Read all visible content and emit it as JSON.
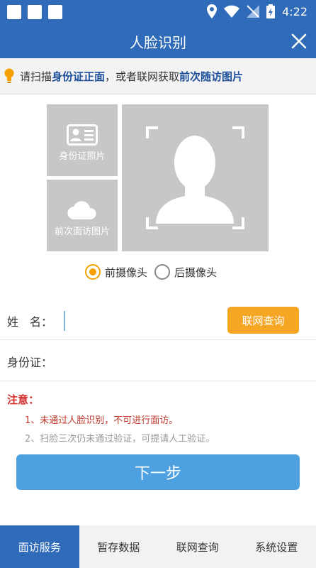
{
  "status_bar": {
    "time": "4:22"
  },
  "header": {
    "title": "人脸识别"
  },
  "tip": {
    "prefix": "请扫描",
    "highlight1": "身份证正面",
    "middle": "，或者联网获取",
    "highlight2": "前次随访图片"
  },
  "photos": {
    "id_label": "身份证照片",
    "prev_label": "前次面访图片"
  },
  "camera": {
    "front": "前摄像头",
    "back": "后摄像头",
    "selected": "front"
  },
  "form": {
    "name_label": "姓　名：",
    "name_value": "",
    "query_label": "联网查询",
    "id_label": "身份证：",
    "id_value": ""
  },
  "notice": {
    "title": "注意：",
    "item1": "1、未通过人脸识别，不可进行面访。",
    "item2": "2、扫脸三次仍未通过验证，可提请人工验证。"
  },
  "next_label": "下一步",
  "tabs": [
    {
      "label": "面访服务"
    },
    {
      "label": "暂存数据"
    },
    {
      "label": "联网查询"
    },
    {
      "label": "系统设置"
    }
  ],
  "colors": {
    "primary": "#2f6bb8",
    "accent": "#f5a623",
    "button": "#4ea1e0",
    "warning": "#d32f2f"
  }
}
